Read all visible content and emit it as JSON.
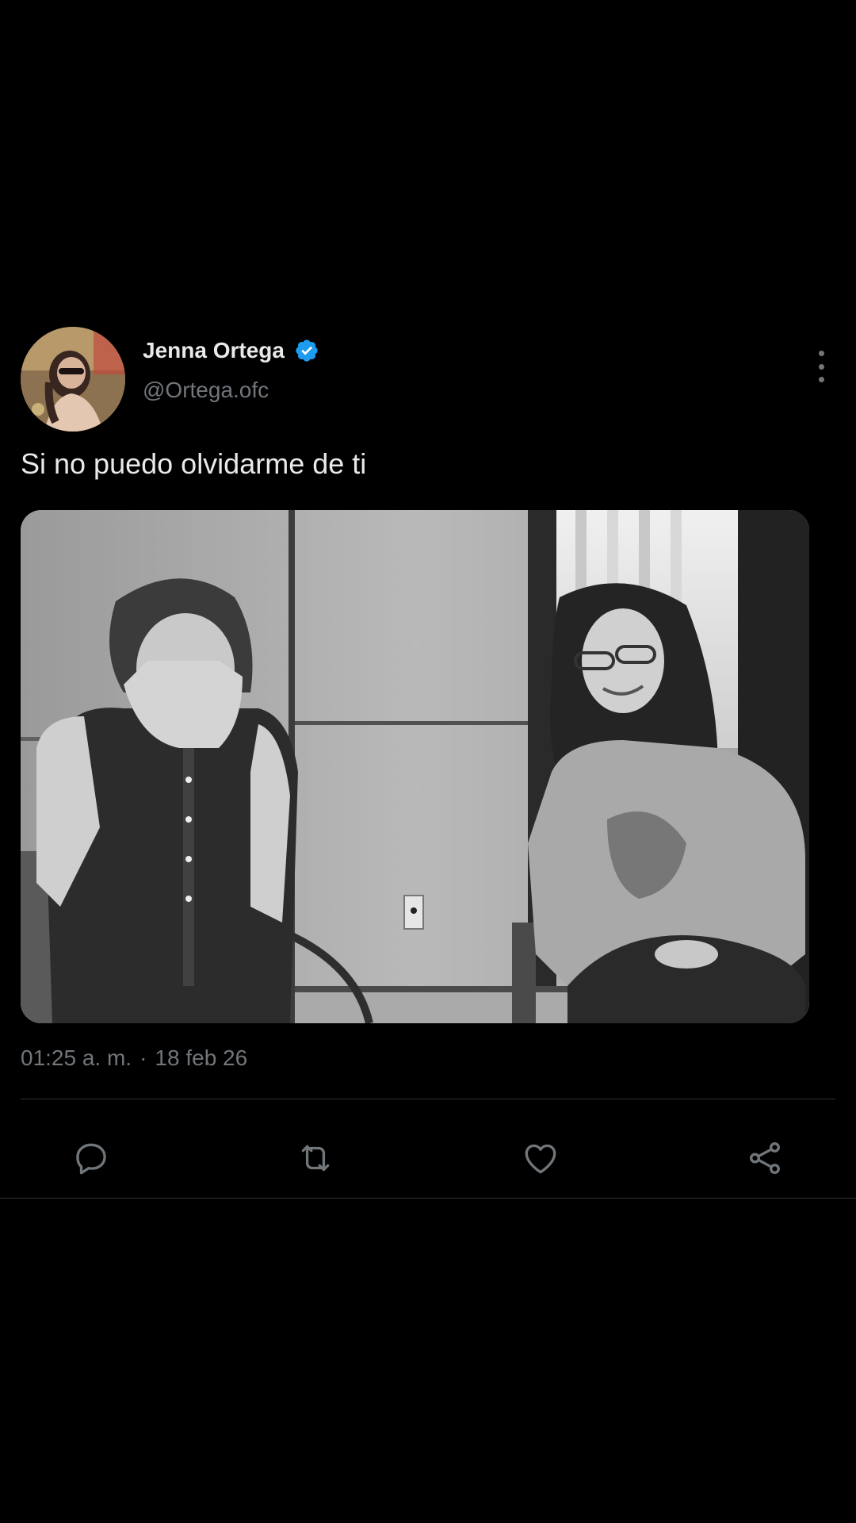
{
  "tweet": {
    "author_name": "Jenna Ortega",
    "author_handle": "@Ortega.ofc",
    "verified": true,
    "text": "Si no puedo olvidarme de ti",
    "time": "01:25 a. m.",
    "separator": "·",
    "date": "18 feb 26",
    "media_description_icon": "photo-two-people-black-and-white"
  },
  "actions": {
    "reply_icon": "reply-icon",
    "retweet_icon": "retweet-icon",
    "like_icon": "heart-icon",
    "share_icon": "share-icon"
  },
  "colors": {
    "background": "#000000",
    "text_primary": "#e7e9ea",
    "text_secondary": "#71767b",
    "verified_blue": "#1d9bf0",
    "divider": "#2f3336"
  }
}
